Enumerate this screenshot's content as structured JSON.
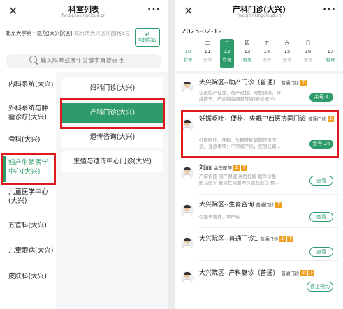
{
  "left": {
    "title": "科室列表",
    "url": "fwcbj.linkingcloud.cn",
    "hospital_name": "北京大学第一医院(大兴院区)",
    "hospital_address": "北京市大兴区乐园路5号",
    "switch_label": "切换院区",
    "search_placeholder": "输入科室或医生关键字直接查找",
    "categories": [
      {
        "label": "内科系统(大兴)"
      },
      {
        "label": "外科系统与肿瘤诊疗(大兴)"
      },
      {
        "label": "骨科(大兴)"
      },
      {
        "label": "妇产生殖医学中心(大兴)"
      },
      {
        "label": "儿童医学中心(大兴)"
      },
      {
        "label": "五官科(大兴)"
      },
      {
        "label": "儿童眼病(大兴)"
      },
      {
        "label": "皮肤科(大兴)"
      }
    ],
    "departments": [
      {
        "label": "妇科门诊(大兴)"
      },
      {
        "label": "产科门诊(大兴)"
      },
      {
        "label": "遗传咨询(大兴)"
      },
      {
        "label": "生殖与遗传中心门诊(大兴)"
      }
    ],
    "selected_category_index": 3,
    "selected_department_index": 1
  },
  "right": {
    "title": "产科门诊(大兴)",
    "url": "fwcbj.linkingcloud.cn",
    "year_month": "2025-02-12",
    "days": [
      {
        "weekday": "一",
        "date": "10",
        "status": "有号"
      },
      {
        "weekday": "二",
        "date": "11",
        "status": "无号"
      },
      {
        "weekday": "三",
        "date": "12",
        "status": "有号"
      },
      {
        "weekday": "四",
        "date": "13",
        "status": "有号"
      },
      {
        "weekday": "五",
        "date": "14",
        "status": "无号"
      },
      {
        "weekday": "六",
        "date": "15",
        "status": "无号"
      },
      {
        "weekday": "日",
        "date": "16",
        "status": "无号"
      },
      {
        "weekday": "一",
        "date": "17",
        "status": "有号"
      }
    ],
    "doctors": [
      {
        "name": "大兴院区--助产门诊（普通）",
        "type": "普通门诊",
        "badge": "下",
        "desc1": "仅限临产征兆、待产过程、分娩镇痛、分",
        "desc2": "娩技巧、产房特色服务等咨询(妊娠30...",
        "action": "余号:4"
      },
      {
        "name": "妊娠呕吐，便秘，失眠中西医协同门诊",
        "type": "普通门诊",
        "badge": "上",
        "desc1": "妊娠呕吐、便秘、失眠等妊娠期常见不",
        "desc2": "适。注意事项：不常规产检，仅限妊娠...",
        "action": "余号:24"
      },
      {
        "name": "刘喆",
        "title": "主任医师",
        "badge1": "上",
        "badge2": "下",
        "desc1": "产前诊断 围产保健 高危妊娠 超声诊断",
        "desc2": "胎儿医学 复杂性双胎的保健及治疗 预...",
        "action": "查看"
      },
      {
        "name": "大兴院区--生育咨询",
        "type": "普通门诊",
        "badge": "下",
        "desc1": "仅限于咨询，不产检",
        "action": "查看"
      },
      {
        "name": "大兴院区--普通门诊1",
        "type": "普通门诊",
        "badge1": "上",
        "badge2": "下",
        "action": "查看"
      },
      {
        "name": "大兴院区--产科复诊（普通）",
        "type": "普通门诊",
        "badge1": "上",
        "badge2": "下",
        "action": "停止预约"
      }
    ]
  },
  "colors": {
    "accent": "#2d9c6a",
    "highlight": "#e0191f",
    "badge": "#f0a020"
  }
}
